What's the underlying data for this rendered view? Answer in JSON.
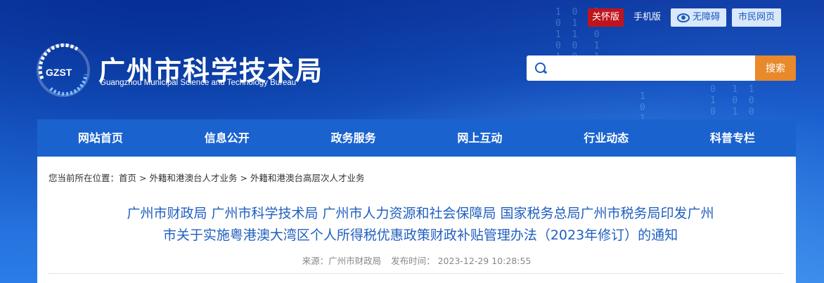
{
  "header": {
    "logo_text": "GZST",
    "title": "广州市科学技术局",
    "subtitle": "Guangzhou Municipal Science and Technology Bureau"
  },
  "toplinks": {
    "care": "关怀版",
    "mobile": "手机版",
    "accessibility": "无障碍",
    "citizen": "市民网页"
  },
  "search": {
    "placeholder": "",
    "button": "搜索"
  },
  "nav": {
    "items": [
      "网站首页",
      "信息公开",
      "政务服务",
      "网上互动",
      "行业动态",
      "科普专栏"
    ]
  },
  "breadcrumb": {
    "prefix": "您当前所在位置：",
    "home": "首页",
    "sep": ">",
    "level1": "外籍和港澳台人才业务",
    "level2": "外籍和港澳台高层次人才业务"
  },
  "article": {
    "title_line1": "广州市财政局 广州市科学技术局 广州市人力资源和社会保障局 国家税务总局广州市税务局印发广州",
    "title_line2": "市关于实施粤港澳大湾区个人所得税优惠政策财政补贴管理办法（2023年修订）的通知",
    "source": "来源：广州市财政局",
    "time": "发布时间： 2023-12-29 10:28:55"
  },
  "colors": {
    "brand_blue": "#1a63cf",
    "search_orange": "#e8892b",
    "care_red": "#c0141c",
    "title_blue": "#1f5fbf"
  }
}
